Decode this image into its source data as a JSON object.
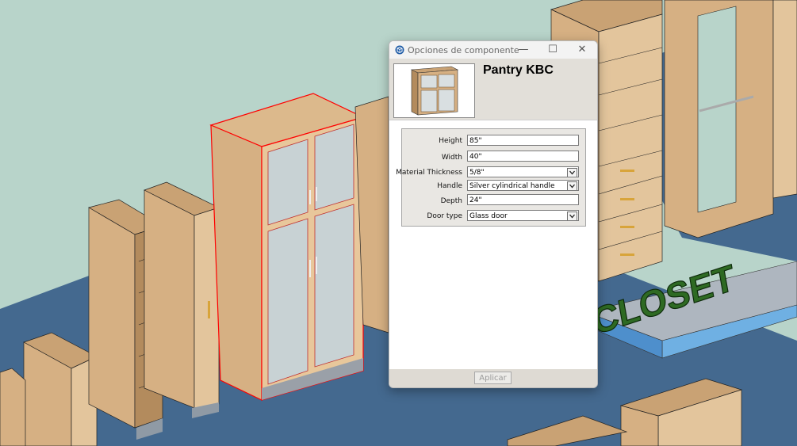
{
  "window": {
    "title": "Opciones de componente",
    "minimize_glyph": "—",
    "maximize_glyph": "☐",
    "close_glyph": "✕"
  },
  "component": {
    "name": "Pantry KBC",
    "thumbnail_icon": "pantry-cabinet-thumbnail"
  },
  "properties": [
    {
      "label": "Height",
      "value": "85\"",
      "type": "text"
    },
    {
      "label": "Width",
      "value": "40\"",
      "type": "text"
    },
    {
      "label": "Material Thickness",
      "value": "5/8\"",
      "type": "select"
    },
    {
      "label": "Handle",
      "value": "Silver cylindrical handle",
      "type": "select"
    },
    {
      "label": "Depth",
      "value": "24\"",
      "type": "text"
    },
    {
      "label": "Door type",
      "value": "Glass door",
      "type": "select"
    }
  ],
  "footer": {
    "apply_label": "Aplicar"
  },
  "scene": {
    "sign_text": "CLOSET",
    "colors": {
      "background": "#b8d4ca",
      "floor": "#44698f",
      "wood": "#d6b083",
      "selection": "#ff0000",
      "sign": "#2e6a23"
    }
  }
}
